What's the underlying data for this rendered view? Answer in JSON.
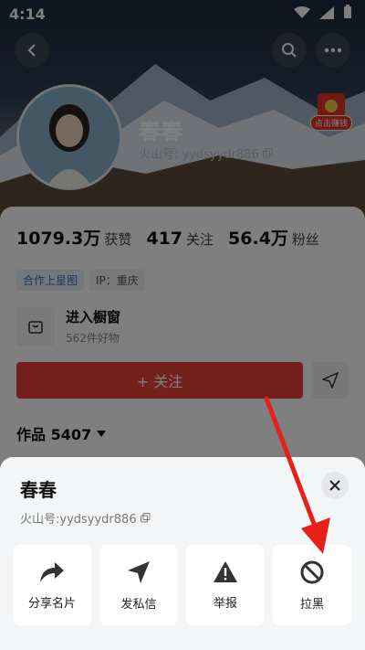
{
  "status_bar": {
    "time": "4:14"
  },
  "profile": {
    "name": "春春",
    "volcano_id": "火山号: yydsyydr886",
    "red_packet_label": "点击赚钱"
  },
  "stats": [
    {
      "num": "1079.3万",
      "label": "获赞"
    },
    {
      "num": "417",
      "label": "关注"
    },
    {
      "num": "56.4万",
      "label": "粉丝"
    }
  ],
  "tags": {
    "star_map": "合作上星图",
    "ip": "IP：重庆"
  },
  "shop": {
    "title": "进入橱窗",
    "subtitle": "562件好物"
  },
  "follow": {
    "label": "+ 关注"
  },
  "works": {
    "label": "作品 5407"
  },
  "sheet": {
    "name": "春春",
    "volcano_id": "火山号:yydsyydr886",
    "actions": [
      {
        "label": "分享名片",
        "icon": "share-arrow-icon"
      },
      {
        "label": "发私信",
        "icon": "send-message-icon"
      },
      {
        "label": "举报",
        "icon": "warning-icon"
      },
      {
        "label": "拉黑",
        "icon": "block-icon"
      }
    ]
  },
  "colors": {
    "accent_red": "#e8413a",
    "annotation_arrow": "#e8201a"
  }
}
